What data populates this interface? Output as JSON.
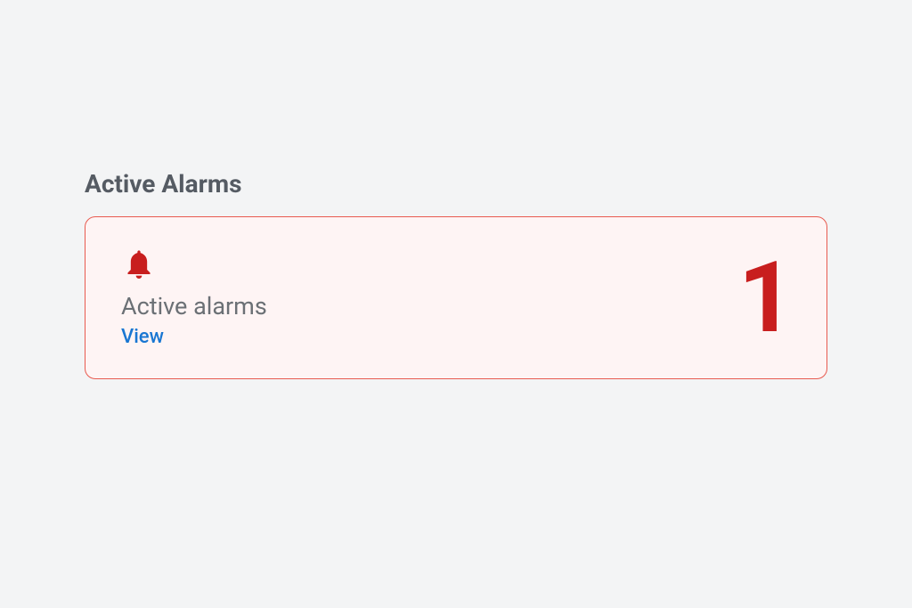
{
  "section": {
    "title": "Active Alarms"
  },
  "alarm_card": {
    "label": "Active alarms",
    "view_link": "View",
    "count": "1"
  },
  "colors": {
    "alarm_red": "#c81e1e",
    "card_border": "#e85a4f",
    "card_bg": "#fef4f4",
    "link_blue": "#1976d2"
  },
  "icons": {
    "bell": "bell-icon"
  }
}
